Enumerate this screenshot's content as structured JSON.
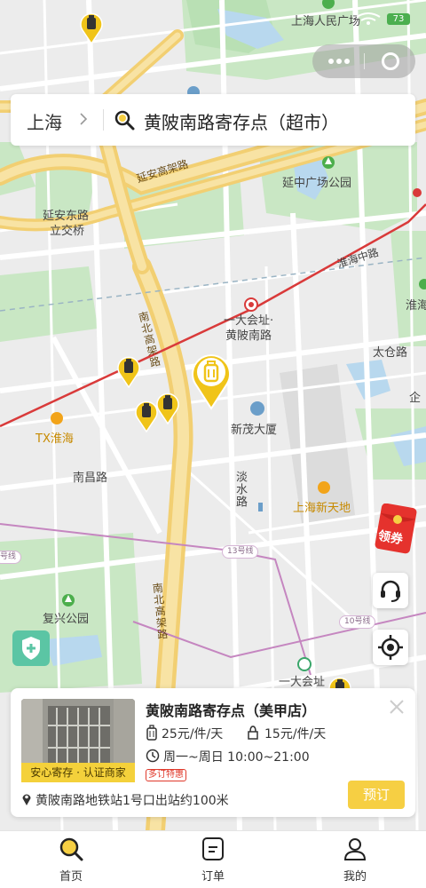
{
  "status_bar": {
    "signal_badge": "73"
  },
  "search": {
    "city": "上海",
    "query": "黄陂南路寄存点（超市）"
  },
  "map": {
    "labels": {
      "people_square": "上海人民广场",
      "yanan_elevated": "延安高架路",
      "yanzhong_park": "延中广场公园",
      "yanan_interchange_1": "延安东路",
      "yanan_interchange_2": "立交桥",
      "huaihai_mid": "淮海中路",
      "huaihai": "淮海",
      "site_1": "一大会址·",
      "site_2": "黄陂南路",
      "nanbei_elevated": "南北高架路",
      "taicang_road": "太仓路",
      "qi": "企",
      "tx_huaihai": "TX淮海",
      "xinmao": "新茂大厦",
      "nanchang_road": "南昌路",
      "danshui_road": "淡水路",
      "xintiandi": "上海新天地",
      "line13": "13号线",
      "line10": "10号线",
      "line_misc": "号线",
      "nanbei_elevated_2": "南北高架路",
      "fuxing_park": "复兴公园",
      "site_bottom": "一大会址"
    }
  },
  "coupon": {
    "label": "领券"
  },
  "card": {
    "title": "黄陂南路寄存点（美甲店）",
    "thumb_tag": "安心寄存 · 认证商家",
    "price_large": "25元/件/天",
    "price_small": "15元/件/天",
    "hours": "周一~周日 10:00~21:00",
    "promo": "多订特惠",
    "address": "黄陂南路地铁站1号口出站约100米",
    "book_label": "预订"
  },
  "tabs": [
    {
      "label": "首页",
      "icon": "search-icon",
      "active": true
    },
    {
      "label": "订单",
      "icon": "order-icon",
      "active": false
    },
    {
      "label": "我的",
      "icon": "user-icon",
      "active": false
    }
  ],
  "colors": {
    "accent": "#f6cf43",
    "pin": "#f0c419",
    "metro_red": "#d93a3a",
    "metro_purple": "#c586c0",
    "park": "#c9e7c4",
    "water": "#b8d8ee"
  }
}
